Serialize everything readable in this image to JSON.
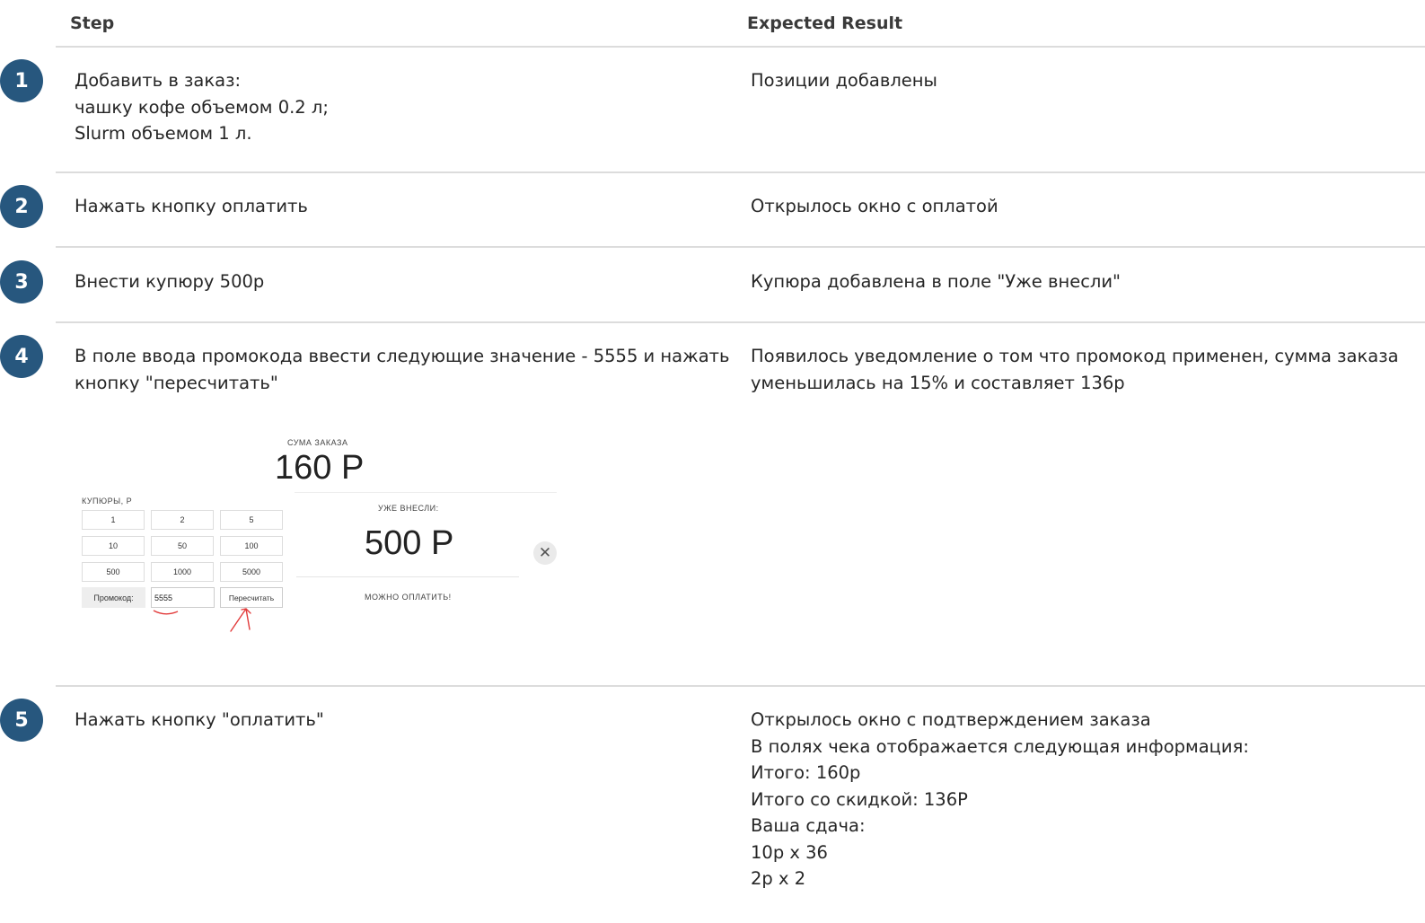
{
  "header": {
    "step_label": "Step",
    "expected_label": "Expected Result"
  },
  "rows": [
    {
      "number": "1",
      "step": [
        "Добавить в заказ:",
        "чашку кофе объемом 0.2 л;",
        "Slurm объемом 1 л."
      ],
      "expected": [
        "Позиции добавлены"
      ]
    },
    {
      "number": "2",
      "step": [
        "Нажать кнопку оплатить"
      ],
      "expected": [
        "Открылось окно с оплатой"
      ]
    },
    {
      "number": "3",
      "step": [
        "Внести купюру 500р"
      ],
      "expected": [
        "Купюра добавлена в поле \"Уже внесли\""
      ]
    },
    {
      "number": "4",
      "step": [
        "В поле ввода промокода ввести следующие значение - 5555 и нажать",
        "кнопку \"пересчитать\""
      ],
      "expected": [
        "Появилось уведомление о том что промокод применен, сумма заказа",
        "уменьшилась на 15% и составляет 136р"
      ]
    },
    {
      "number": "5",
      "step": [
        "Нажать кнопку \"оплатить\""
      ],
      "expected": [
        "Открылось окно с подтверждением заказа",
        "В полях чека отображается следующая информация:",
        "Итого: 160р",
        "Итого со скидкой: 136Р",
        "Ваша сдача:",
        "10р x 36",
        "2р x 2"
      ]
    }
  ],
  "widget": {
    "sum_label": "СУМА ЗАКАЗА",
    "sum_value": "160 Р",
    "bills_label": "КУПЮРЫ, Р",
    "bills": [
      "1",
      "2",
      "5",
      "10",
      "50",
      "100",
      "500",
      "1000",
      "5000"
    ],
    "promo_label": "Промокод:",
    "promo_value": "5555",
    "recalc_label": "Пересчитать",
    "paid_label": "УЖЕ ВНЕСЛИ:",
    "paid_value": "500 Р",
    "can_pay_label": "МОЖНО ОПЛАТИТЬ!",
    "clear_icon": "close-icon",
    "annotation_color": "#e23b3b"
  },
  "colors": {
    "badge": "#27577e",
    "divider": "#dcdcdc"
  }
}
